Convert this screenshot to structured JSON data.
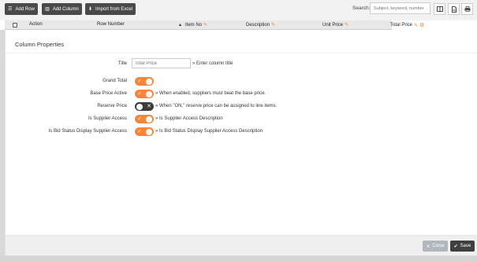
{
  "toolbar": {
    "add_row": "Add Row",
    "add_column": "Add Column",
    "import_excel": "Import from Excel",
    "search_label": "Search:",
    "search_placeholder": "Subject, keyword, number"
  },
  "table": {
    "headers": {
      "action": "Action",
      "row_number": "Row Number",
      "item_no": "Item No",
      "description": "Description",
      "unit_price": "Unit Price",
      "total_price": "Total Price"
    }
  },
  "panel": {
    "title": "Column Properties",
    "title_field": {
      "label": "Title",
      "placeholder": "Total Price",
      "hint": "» Enter column title"
    },
    "settings": [
      {
        "label": "Grand Total",
        "state": "on",
        "description": ""
      },
      {
        "label": "Base Price Active",
        "state": "on",
        "description": "» When enabled, suppliers must beat the base price."
      },
      {
        "label": "Reserve Price",
        "state": "off",
        "description": "» When \"ON,\" reserve price can be assigned to line items."
      },
      {
        "label": "Is Supplier Access",
        "state": "on",
        "description": "» Is Supplier Access Description"
      },
      {
        "label": "Is Bid Status Display Supplier Access",
        "state": "on",
        "description": "» Is Bid Status Display Supplier Access Description"
      }
    ],
    "close_label": "Close",
    "save_label": "Save"
  },
  "colors": {
    "toggle_on": "#f5863b",
    "toggle_off": "#3b3b3b",
    "toolbar_button": "#4a4a4a",
    "close_button": "#b0b7bf",
    "save_button": "#3f3f3f"
  }
}
